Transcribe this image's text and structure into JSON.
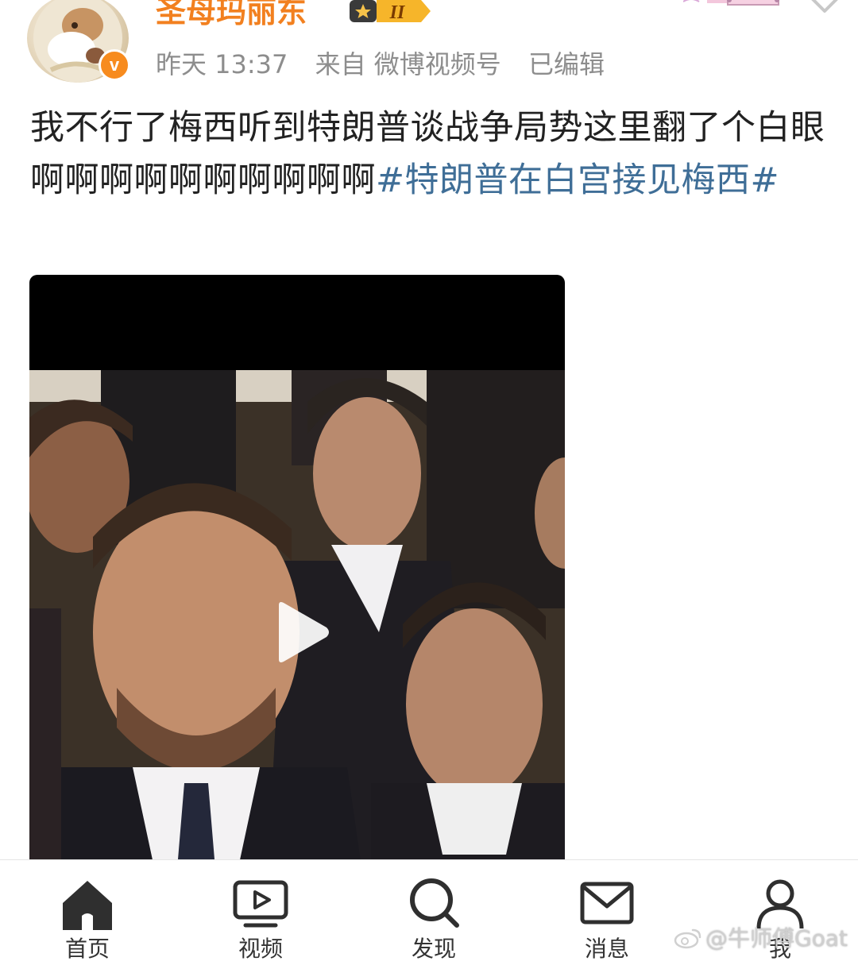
{
  "user": {
    "name": "圣母玛丽东",
    "verified_mark": "v",
    "level_badge": "II",
    "avatar_icon": "avatar-icon"
  },
  "meta": {
    "time": "昨天 13:37",
    "source": "来自 微博视频号",
    "edited": "已编辑"
  },
  "post": {
    "text": "我不行了梅西听到特朗普谈战争局势这里翻了个白眼啊啊啊啊啊啊啊啊啊啊",
    "hashtag": "#特朗普在白宫接见梅西#"
  },
  "video": {
    "play_icon": "play-icon"
  },
  "tabbar": {
    "items": [
      {
        "label": "首页",
        "icon": "home-icon"
      },
      {
        "label": "视频",
        "icon": "video-icon"
      },
      {
        "label": "发现",
        "icon": "search-icon"
      },
      {
        "label": "消息",
        "icon": "message-icon"
      },
      {
        "label": "我",
        "icon": "profile-icon"
      }
    ]
  },
  "watermark": {
    "text": "@牛师傅Goat"
  },
  "colors": {
    "username": "#f2801f",
    "hashtag": "#3f6e97",
    "meta": "#8d8d8d",
    "verified": "#f78b1e"
  }
}
